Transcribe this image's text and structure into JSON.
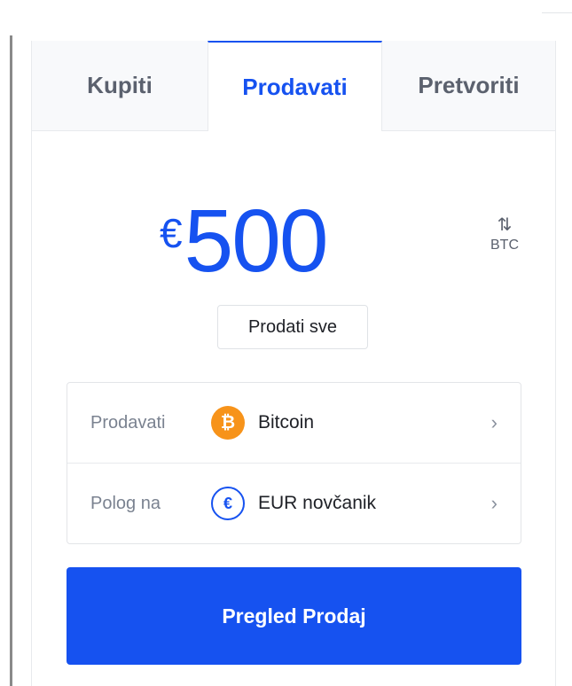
{
  "tabs": [
    {
      "label": "Kupiti",
      "active": false
    },
    {
      "label": "Prodavati",
      "active": true
    },
    {
      "label": "Pretvoriti",
      "active": false
    }
  ],
  "amount": {
    "currency_symbol": "€",
    "value": "500"
  },
  "unit_toggle": {
    "arrows": "⇅",
    "unit": "BTC"
  },
  "sell_all_label": "Prodati sve",
  "rows": [
    {
      "label": "Prodavati",
      "icon": "bitcoin-icon",
      "icon_glyph": "₿",
      "value": "Bitcoin",
      "chevron": "›"
    },
    {
      "label": "Polog na",
      "icon": "euro-wallet-icon",
      "icon_glyph": "€",
      "value": "EUR novčanik",
      "chevron": "›"
    }
  ],
  "primary_button_label": "Pregled Prodaj",
  "colors": {
    "accent": "#1652f0",
    "bitcoin": "#f7931a",
    "tab_inactive_bg": "#f8f9fb"
  }
}
